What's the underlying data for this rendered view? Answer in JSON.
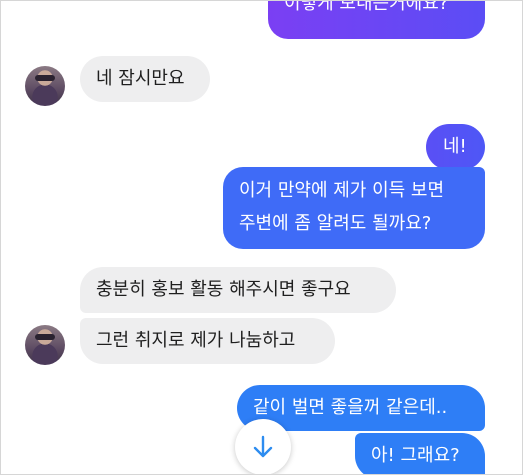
{
  "messages": {
    "m1": "이렇게 보내는거에요?",
    "m2": "네 잠시만요",
    "m3": "네!",
    "m4_line1": "이거 만약에 제가 이득 보면",
    "m4_line2": "주변에 좀 알려도 될까요?",
    "m5": "충분히 홍보 활동 해주시면 좋구요",
    "m6": "그런 취지로 제가 나눔하고",
    "m7": "같이 벌면 좋을꺼 같은데..",
    "m8": "아! 그래요?"
  },
  "icons": {
    "scroll_down": "arrow-down-icon",
    "avatar": "avatar"
  },
  "colors": {
    "incoming_bubble": "#eeeeef",
    "outgoing_purple": "#7b3ff3",
    "outgoing_blue": "#2e7ef6",
    "scroll_arrow": "#2d8cf0"
  }
}
